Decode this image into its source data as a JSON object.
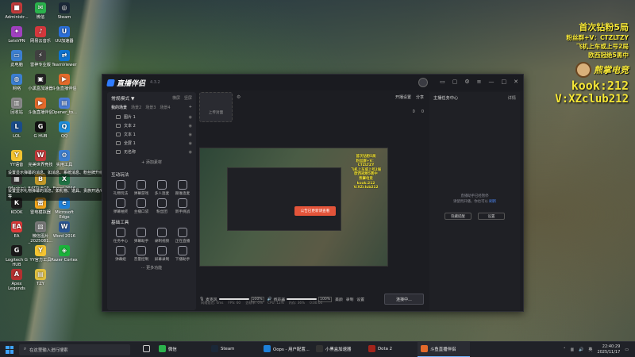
{
  "desktop_icons": [
    {
      "label": "Administr...",
      "glyph": "■",
      "color": "#c23a3a"
    },
    {
      "label": "微信",
      "glyph": "✉",
      "color": "#2bb24c"
    },
    {
      "label": "Steam",
      "glyph": "◎",
      "color": "#1b2838"
    },
    {
      "label": "LetsVPN",
      "glyph": "✦",
      "color": "#a040c0"
    },
    {
      "label": "网易云音乐",
      "glyph": "♪",
      "color": "#d4373c"
    },
    {
      "label": "UU加速器",
      "glyph": "U",
      "color": "#2a6ed8"
    },
    {
      "label": "此电脑",
      "glyph": "▭",
      "color": "#3c7fd1"
    },
    {
      "label": "雷神专业版",
      "glyph": "⚡",
      "color": "#404040"
    },
    {
      "label": "TeamViewer",
      "glyph": "⇄",
      "color": "#0e73d1"
    },
    {
      "label": "网络",
      "glyph": "◍",
      "color": "#3c7fd1"
    },
    {
      "label": "小黑盒加速器",
      "glyph": "▣",
      "color": "#222"
    },
    {
      "label": "斗鱼直播伴侣",
      "glyph": "▶",
      "color": "#e36a2b"
    },
    {
      "label": "回收站",
      "glyph": "▥",
      "color": "#888"
    },
    {
      "label": "斗鱼直播伴侣",
      "glyph": "▶",
      "color": "#e36a2b"
    },
    {
      "label": "Opener_to...",
      "glyph": "▤",
      "color": "#4a7dd6"
    },
    {
      "label": "LOL",
      "glyph": "L",
      "color": "#1a4c8a"
    },
    {
      "label": "G HUB",
      "glyph": "G",
      "color": "#111"
    },
    {
      "label": "QQ",
      "glyph": "Q",
      "color": "#1d8fe0"
    },
    {
      "label": "YY语音",
      "glyph": "Y",
      "color": "#f5c431"
    },
    {
      "label": "完美世界竞技",
      "glyph": "W",
      "color": "#c23a3a"
    },
    {
      "label": "实用工具",
      "glyph": "⚙",
      "color": "#3c7fd1"
    },
    {
      "label": "(Machin)",
      "glyph": "▦",
      "color": "#333"
    },
    {
      "label": "BATTLEGR...",
      "glyph": "B",
      "color": "#c49a2a"
    },
    {
      "label": "Excel 2016",
      "glyph": "X",
      "color": "#1f7244"
    },
    {
      "label": "KOOK",
      "glyph": "K",
      "color": "#1c1c1c"
    },
    {
      "label": "雷电模拟器",
      "glyph": "雷",
      "color": "#f1a51d"
    },
    {
      "label": "Microsoft Edge",
      "glyph": "e",
      "color": "#1e80d8"
    },
    {
      "label": "EA",
      "glyph": "EA",
      "color": "#e33a3a"
    },
    {
      "label": "微信图片_2025081...",
      "glyph": "▨",
      "color": "#777"
    },
    {
      "label": "Word 2016",
      "glyph": "W",
      "color": "#2b5797"
    },
    {
      "label": "Logitech G HUB",
      "glyph": "G",
      "color": "#1a1a1a"
    },
    {
      "label": "YY官方工具",
      "glyph": "Y",
      "color": "#f5c431"
    },
    {
      "label": "Razer Cortex",
      "glyph": "◈",
      "color": "#1bb23b"
    },
    {
      "label": "Apex Legends",
      "glyph": "A",
      "color": "#b53030"
    },
    {
      "label": "TZY",
      "glyph": "▤",
      "color": "#e0c040"
    }
  ],
  "tooltips": [
    "设置显示弹幕的消息、如消息、系统消息、粉丝牌升级等",
    "设置显示礼物弹幕的消息，如礼物、道具、贵族开通/续费、贴粉丝、消费等"
  ],
  "overlay": {
    "title": "首次钻粉5局",
    "line1": "粉丝群+V：CTZLTZY",
    "line2": "飞机上车或上号2局",
    "line3": "欧西冠绝5黑中",
    "brand": "熊掌电竞",
    "kook": "kook:212",
    "vx": "V:XZclub212"
  },
  "app": {
    "name": "直播伴侣",
    "version": "4.3.2",
    "mode_label": "常规模式 ▼",
    "mode_links": [
      "横屏",
      "竖屏"
    ],
    "scene_tabs": [
      "我的场景",
      "场景2",
      "场景3",
      "场景4"
    ],
    "sources": [
      "图片 1",
      "文本 2",
      "文本 1",
      "全屏 1",
      "无名称"
    ],
    "add_source": "+ 添加素材",
    "section_interact": "互动玩法",
    "interact_tools": [
      "礼物玩法",
      "弹幕游戏",
      "多人连麦",
      "跟谁连麦",
      "弹幕抽奖",
      "主播口袋",
      "粉丝团",
      "新手挑战"
    ],
    "section_basic": "基础工具",
    "basic_tools": [
      "任务中心",
      "弹幕助手",
      "录制视频",
      "正在直播",
      "弹幕姬",
      "音量控制",
      "屏幕录制",
      "下播助手"
    ],
    "more_tools": "··· 更多功能",
    "cover_label": "上传封面",
    "top_actions": [
      "开播设置",
      "分享"
    ],
    "counters": [
      "0",
      "0"
    ],
    "preview_button": "公告已更新请查看",
    "mini_overlay": [
      "首次钻粉5局",
      "粉丝群+V：CTZLTZY",
      "飞机上车或上号2局",
      "欧西冠绝5黑中",
      "熊掌电竞",
      "kook:212",
      "V:XZclub212"
    ],
    "mic_label": "麦克风",
    "mic_vol": "100%",
    "speaker_label": "扬声器",
    "speaker_vol": "100%",
    "bottom_actions": [
      "美颜",
      "录制",
      "设置"
    ],
    "live_button": "连接中...",
    "stats": [
      "网络延迟: 0ms",
      "FPS: 60",
      "丢帧率: 0%",
      "CPU: 12%",
      "内存: 36%",
      "0:00:00"
    ],
    "right_title": "主播任务中心",
    "right_detail": "详情",
    "right_msg1": "直播助手已经暂停",
    "right_msg2": "请使用开播，你也可以",
    "right_link": "刷新",
    "right_btns": [
      "隐藏提醒",
      "设置"
    ]
  },
  "taskbar": {
    "search_placeholder": "在这里输入进行搜索",
    "apps": [
      "微信",
      "Steam",
      "Oops - 用户配置...",
      "小黑盒加速器",
      "Dota 2",
      "斗鱼直播伴侣"
    ],
    "time": "22:40:29",
    "date": "2025/11/17"
  }
}
